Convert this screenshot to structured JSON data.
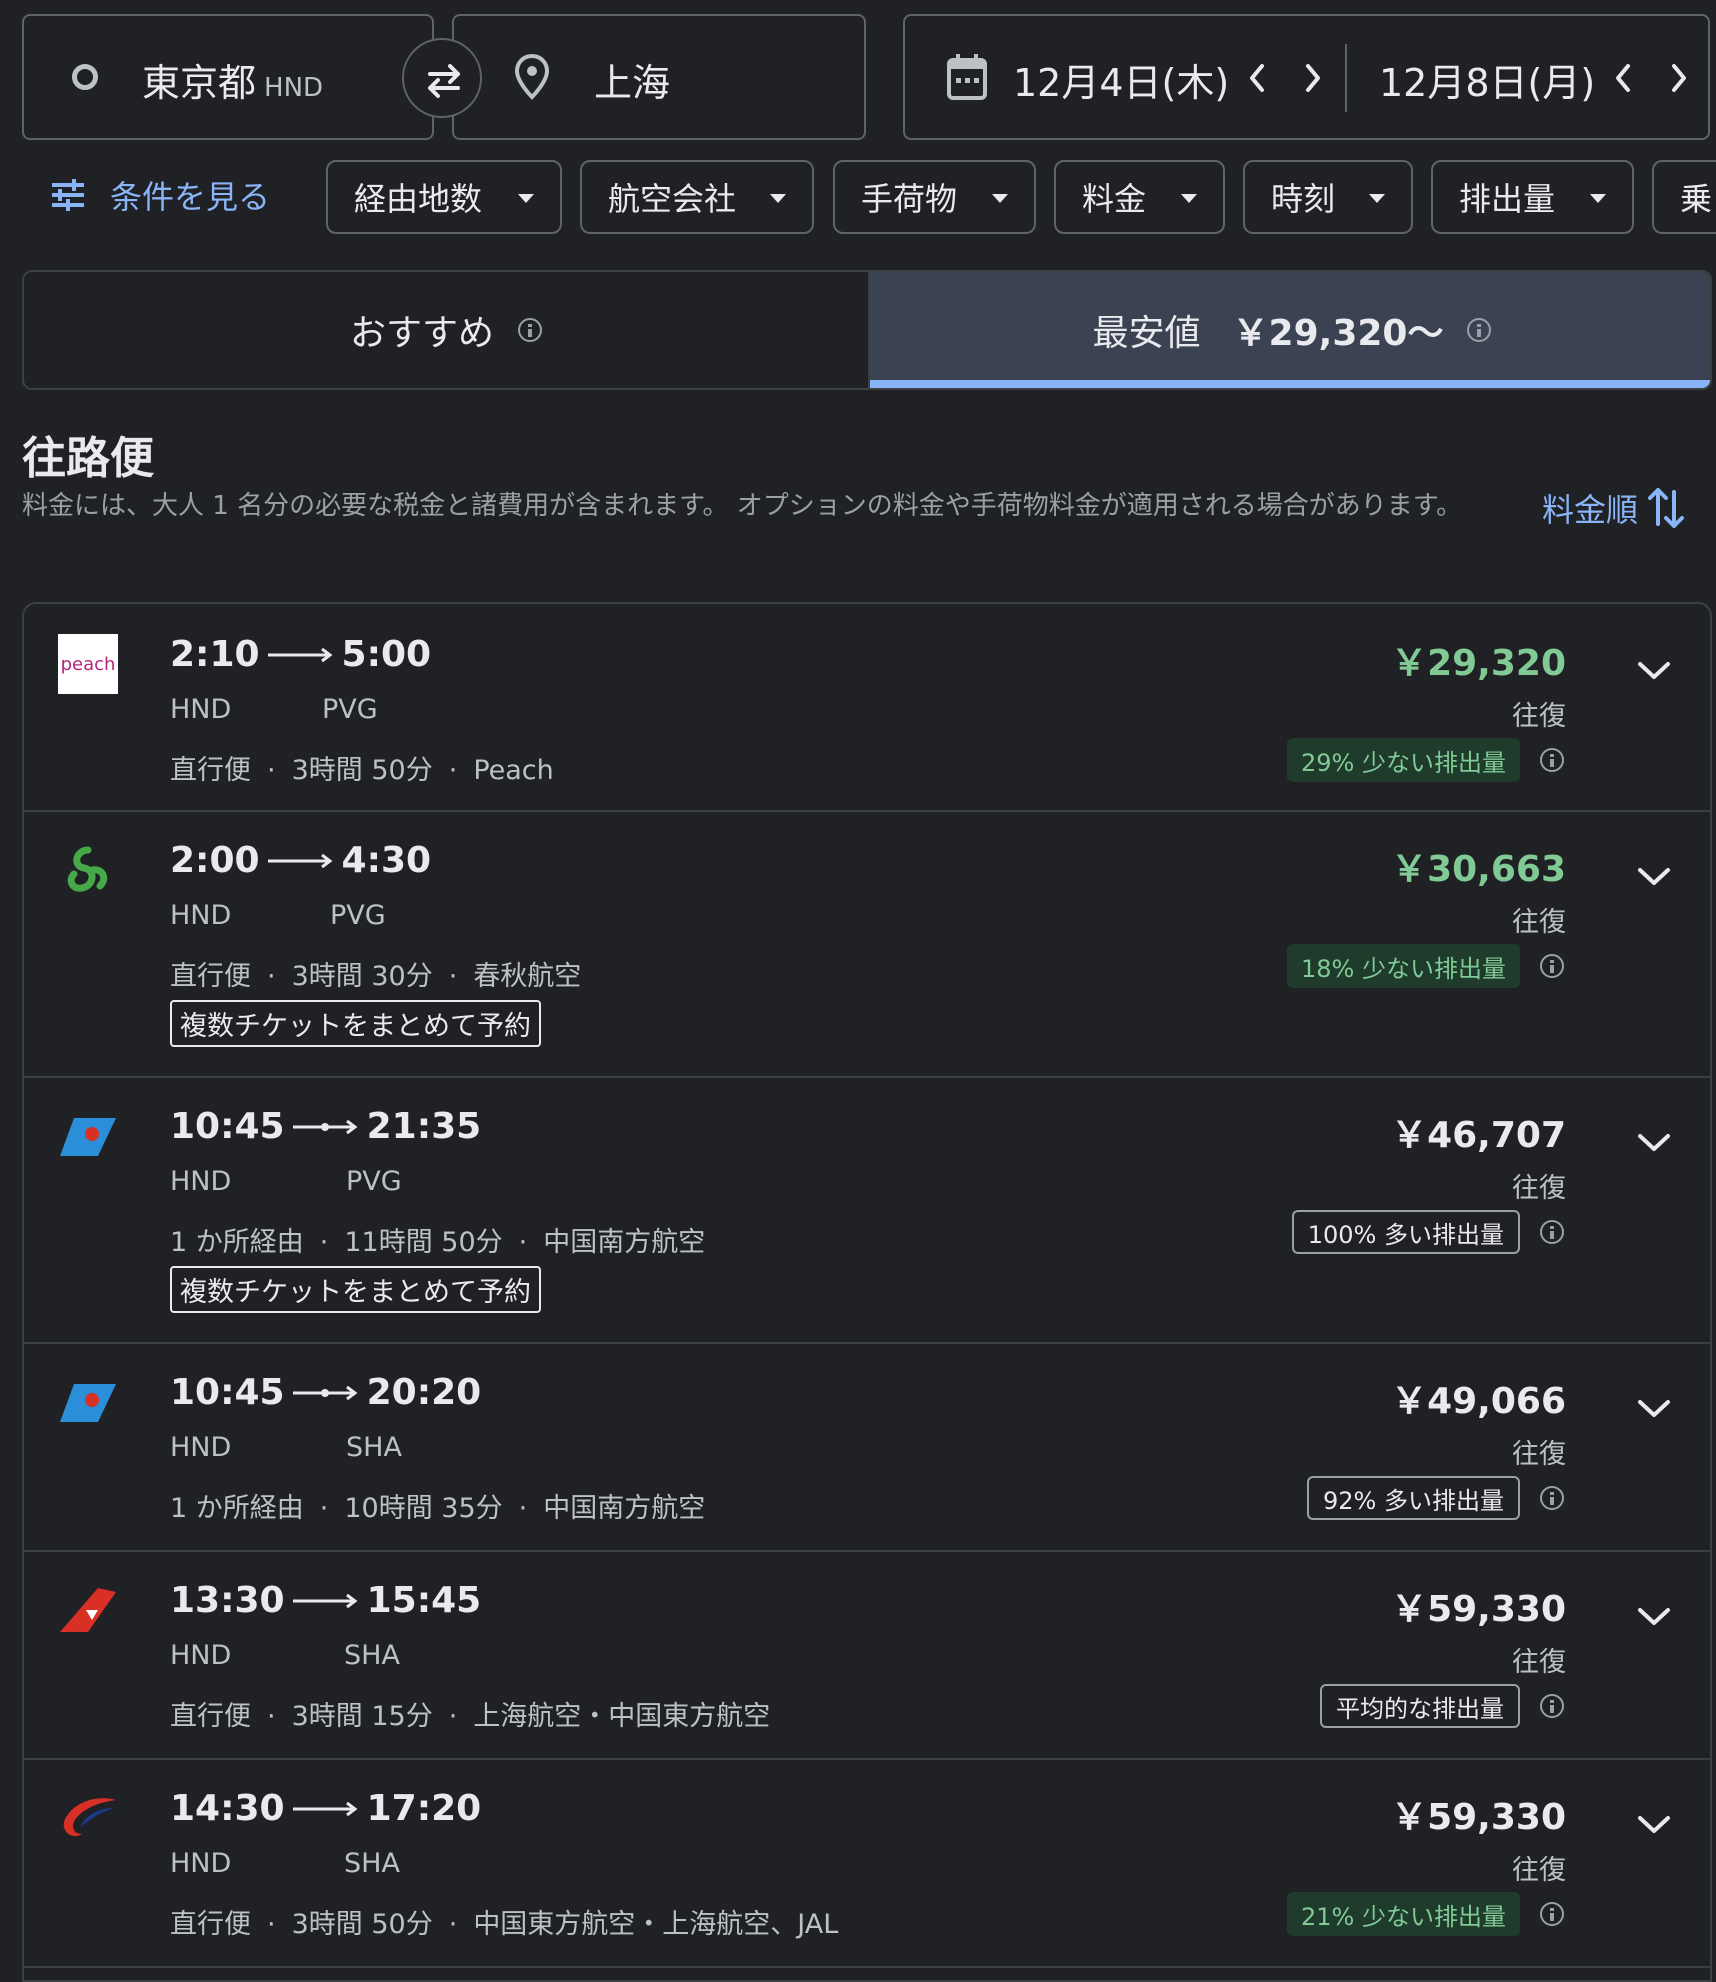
{
  "search": {
    "origin_city": "東京都",
    "origin_code": "HND",
    "destination_city": "上海",
    "depart_date": "12月4日(木)",
    "return_date": "12月8日(月)"
  },
  "filters": {
    "all_label": "条件を見る",
    "chips": [
      "経由地数",
      "航空会社",
      "手荷物",
      "料金",
      "時刻",
      "排出量",
      "乗"
    ]
  },
  "tabs": {
    "recommended": "おすすめ",
    "cheapest": "最安値",
    "cheapest_price": "￥29,320～"
  },
  "section": {
    "title": "往路便",
    "note": "料金には、大人 1 名分の必要な税金と諸費用が含まれます。 オプションの料金や手荷物料金が適用される場合があります。",
    "sort_label": "料金順"
  },
  "colors": {
    "background": "#202124",
    "accent": "#8ab4f8",
    "green": "#81c995"
  },
  "flights": [
    {
      "logo": "peach-logo",
      "depart": "2:10",
      "arrive": "5:00",
      "from": "HND",
      "to": "PVG",
      "stops": "直行便",
      "duration": "3時間 50分",
      "airline": "Peach",
      "multi_ticket": "",
      "price": "￥29,320",
      "price_color": "green",
      "trip": "往復",
      "emissions": "29% 少ない排出量",
      "emissions_level": "low"
    },
    {
      "logo": "spring-airlines-logo",
      "depart": "2:00",
      "arrive": "4:30",
      "from": "HND",
      "to": "PVG",
      "stops": "直行便",
      "duration": "3時間 30分",
      "airline": "春秋航空",
      "multi_ticket": "複数チケットをまとめて予約",
      "price": "￥30,663",
      "price_color": "green",
      "trip": "往復",
      "emissions": "18% 少ない排出量",
      "emissions_level": "low"
    },
    {
      "logo": "china-southern-logo",
      "depart": "10:45",
      "arrive": "21:35",
      "from": "HND",
      "to": "PVG",
      "stops": "1 か所経由",
      "duration": "11時間 50分",
      "airline": "中国南方航空",
      "multi_ticket": "複数チケットをまとめて予約",
      "price": "￥46,707",
      "price_color": "white",
      "trip": "往復",
      "emissions": "100% 多い排出量",
      "emissions_level": "high"
    },
    {
      "logo": "china-southern-logo",
      "depart": "10:45",
      "arrive": "20:20",
      "from": "HND",
      "to": "SHA",
      "stops": "1 か所経由",
      "duration": "10時間 35分",
      "airline": "中国南方航空",
      "multi_ticket": "",
      "price": "￥49,066",
      "price_color": "white",
      "trip": "往復",
      "emissions": "92% 多い排出量",
      "emissions_level": "high"
    },
    {
      "logo": "shanghai-airlines-logo",
      "depart": "13:30",
      "arrive": "15:45",
      "from": "HND",
      "to": "SHA",
      "stops": "直行便",
      "duration": "3時間 15分",
      "airline": "上海航空・中国東方航空",
      "multi_ticket": "",
      "price": "￥59,330",
      "price_color": "white",
      "trip": "往復",
      "emissions": "平均的な排出量",
      "emissions_level": "high"
    },
    {
      "logo": "china-eastern-logo",
      "depart": "14:30",
      "arrive": "17:20",
      "from": "HND",
      "to": "SHA",
      "stops": "直行便",
      "duration": "3時間 50分",
      "airline": "中国東方航空・上海航空、JAL",
      "multi_ticket": "",
      "price": "￥59,330",
      "price_color": "white",
      "trip": "往復",
      "emissions": "21% 少ない排出量",
      "emissions_level": "low"
    }
  ]
}
